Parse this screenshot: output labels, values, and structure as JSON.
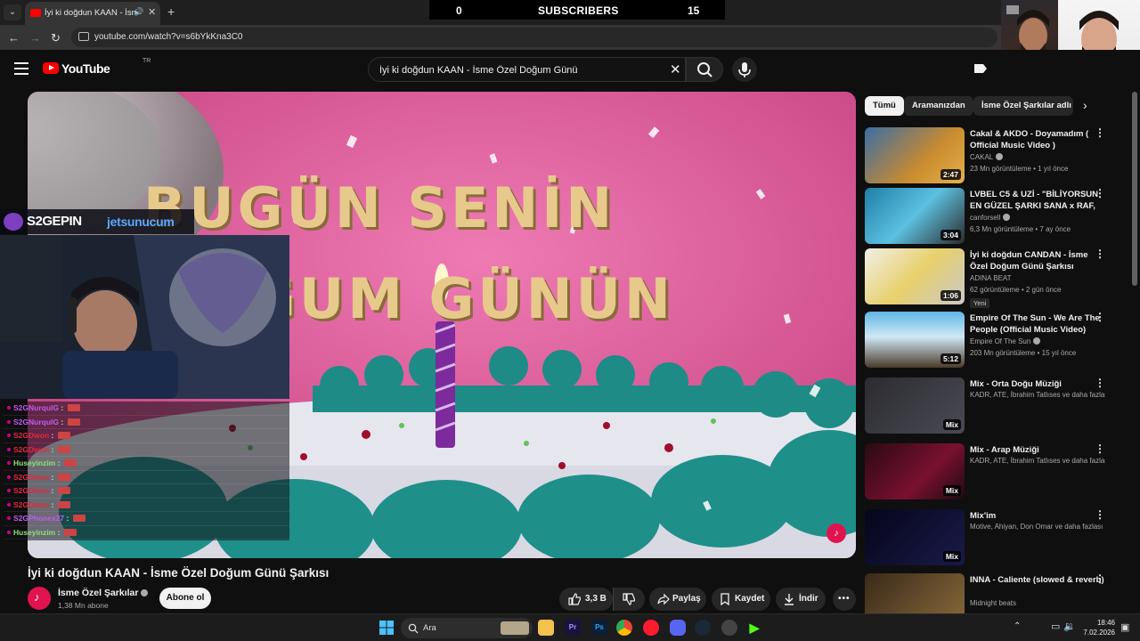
{
  "browser": {
    "tab_title": "İyi ki doğdun KAAN - İsme Ö",
    "url": "youtube.com/watch?v=s6bYkKna3C0"
  },
  "stream_overlay": {
    "sub_counter_left": "0",
    "sub_counter_label": "SUBSCRIBERS",
    "sub_counter_right": "15",
    "brand_name": "S2GEPIN",
    "sponsor": "jetsunucum",
    "chat": [
      {
        "user": "S2GNurqulG",
        "color": "#c05cf0"
      },
      {
        "user": "S2GNurqulG",
        "color": "#c05cf0"
      },
      {
        "user": "S2GDwon",
        "color": "#e0293a"
      },
      {
        "user": "S2GDwon",
        "color": "#e0293a"
      },
      {
        "user": "Huseyinzim",
        "color": "#8de07a"
      },
      {
        "user": "S2GDwon",
        "color": "#e0293a"
      },
      {
        "user": "S2GDwon",
        "color": "#e0293a"
      },
      {
        "user": "S2GDwon",
        "color": "#e0293a"
      },
      {
        "user": "S2GPhonex27",
        "color": "#c05cf0"
      },
      {
        "user": "Huseyinzim",
        "color": "#8de07a"
      }
    ]
  },
  "masthead": {
    "logo_text": "YouTube",
    "country": "TR",
    "search_value": "İyi ki doğdun KAAN - İsme Özel Doğum Günü"
  },
  "video": {
    "overlay_line1": "BUGÜN SENİN",
    "overlay_line2": "ĞUM GÜNÜN",
    "title": "İyi ki doğdun KAAN - İsme Özel Doğum Günü Şarkısı",
    "channel": "İsme Özel Şarkılar",
    "subs": "1,38 Mn abone",
    "subscribe_label": "Abone ol",
    "likes": "3,3 B",
    "share_label": "Paylaş",
    "save_label": "Kaydet",
    "download_label": "İndir"
  },
  "chips": [
    "Tümü",
    "Aramanızdan",
    "İsme Özel Şarkılar adlı yük"
  ],
  "recommendations": [
    {
      "title": "Cakal & AKDO - Doyamadım ( Official Music Video )",
      "channel": "CAKAL",
      "verified": true,
      "meta": "23 Mn görüntüleme • 1 yıl önce",
      "duration": "2:47",
      "badge": ""
    },
    {
      "title": "LVBEL C5 & UZİ - \"BİLİYORSUN EN GÜZEL ŞARKI SANA x RAF,",
      "channel": "canforsell",
      "verified": true,
      "meta": "6,3 Mn görüntüleme • 7 ay önce",
      "duration": "3:04",
      "badge": ""
    },
    {
      "title": "İyi ki doğdun CANDAN - İsme Özel Doğum Günü Şarkısı",
      "channel": "ADINA BEAT",
      "verified": false,
      "meta": "62 görüntüleme • 2 gün önce",
      "duration": "1:06",
      "badge": "Yeni"
    },
    {
      "title": "Empire Of The Sun - We Are The People (Official Music Video)",
      "channel": "Empire Of The Sun",
      "verified": true,
      "meta": "203 Mn görüntüleme • 15 yıl önce",
      "duration": "5:12",
      "badge": ""
    },
    {
      "title": "Mix - Orta Doğu Müziği",
      "channel": "KADR, ATE, İbrahim Tatlıses ve daha fazlası",
      "verified": false,
      "meta": "",
      "duration": "Mix",
      "badge": ""
    },
    {
      "title": "Mix - Arap Müziği",
      "channel": "KADR, ATE, İbrahim Tatlıses ve daha fazlası",
      "verified": false,
      "meta": "",
      "duration": "Mix",
      "badge": ""
    },
    {
      "title": "Mix'im",
      "channel": "Motive, Ahiyan, Don Omar ve daha fazlası",
      "verified": false,
      "meta": "",
      "duration": "Mix",
      "badge": ""
    },
    {
      "title": "INNA - Caliente (slowed & reverb)",
      "channel": "Midnight beats",
      "verified": false,
      "meta": "",
      "duration": "",
      "badge": ""
    }
  ],
  "taskbar": {
    "search_label": "Ara",
    "time": "18:46",
    "date": "7.02.2026"
  }
}
